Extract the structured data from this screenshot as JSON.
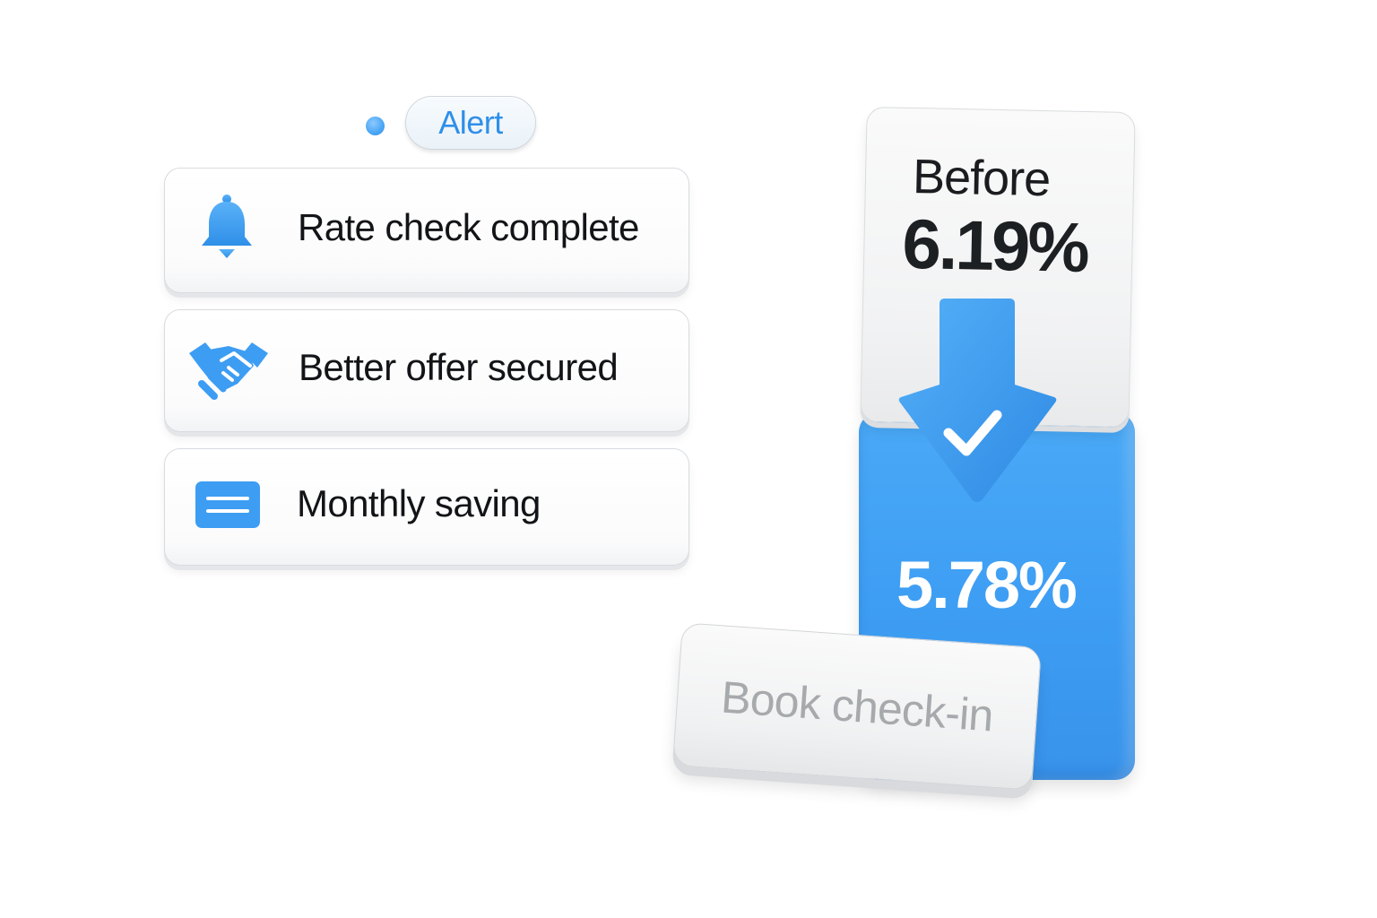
{
  "alert": {
    "label": "Alert"
  },
  "notifications": [
    {
      "label": "Rate check complete",
      "icon": "bell-icon"
    },
    {
      "label": "Better offer secured",
      "icon": "handshake-icon"
    },
    {
      "label": "Monthly saving",
      "icon": "list-card-icon"
    }
  ],
  "rates": {
    "before_label": "Before",
    "before_value": "6.19%",
    "after_value": "5.78%"
  },
  "actions": {
    "book_label": "Book check-in"
  },
  "colors": {
    "accent": "#3d9df3",
    "text": "#121417",
    "muted": "#a7aaad"
  }
}
